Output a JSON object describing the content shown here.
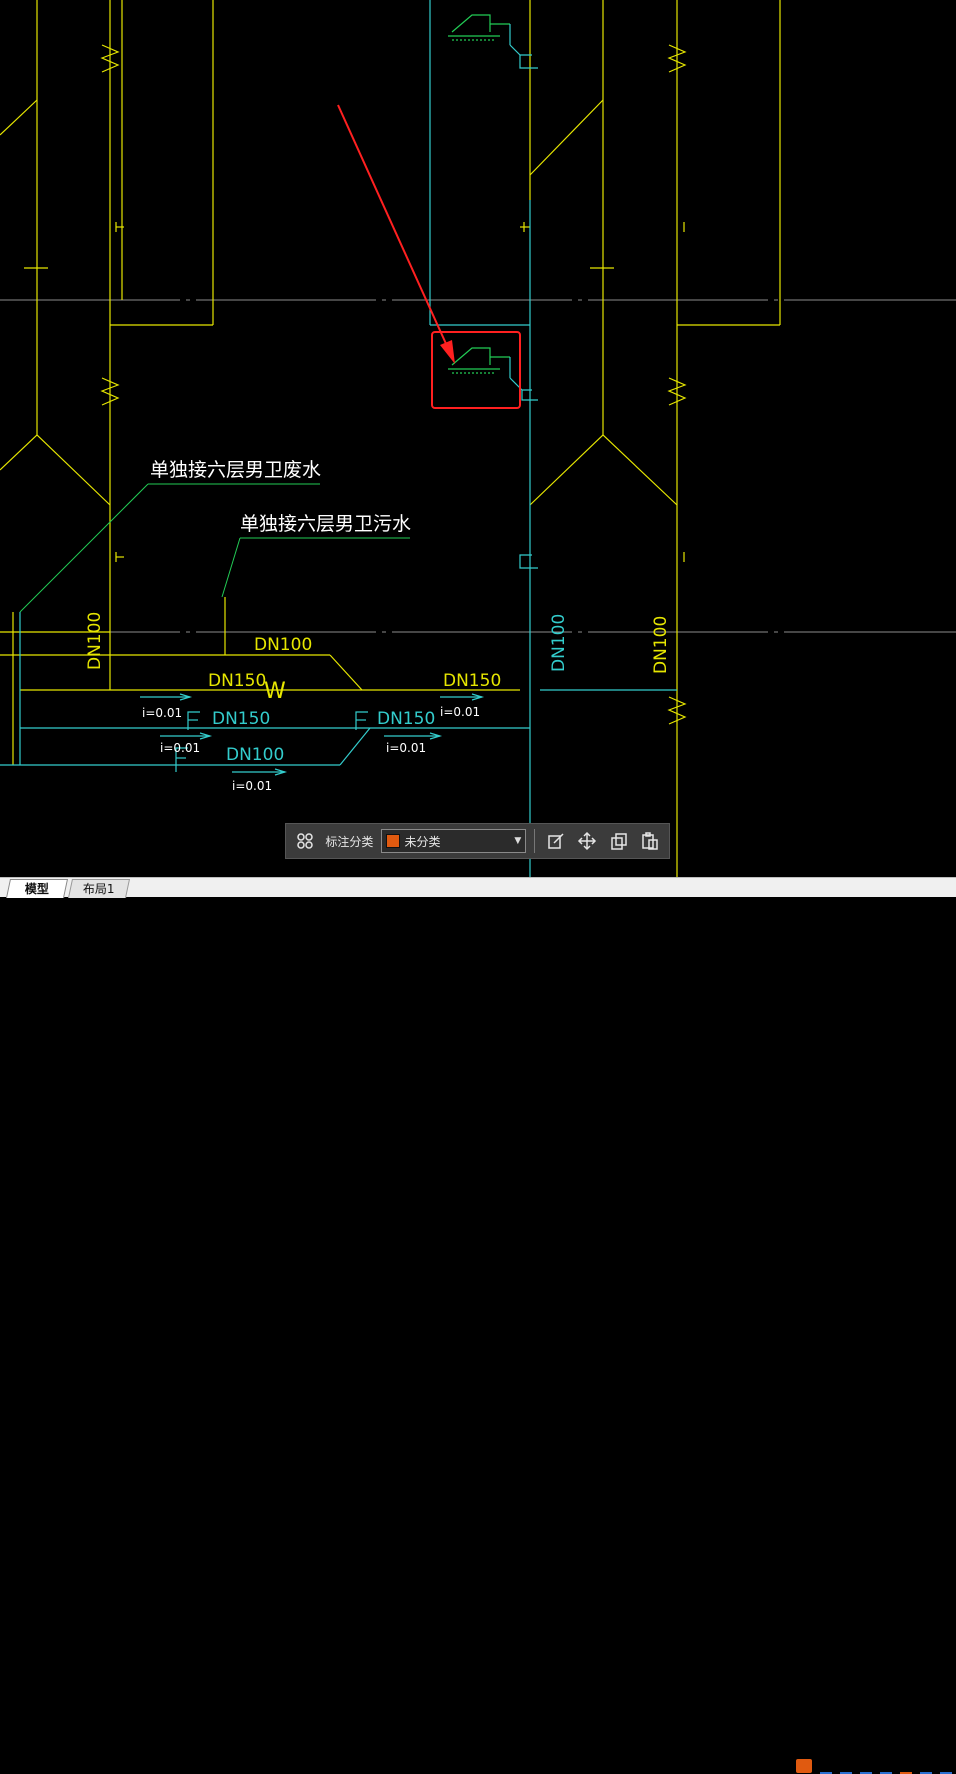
{
  "annotations": {
    "label_waste": "单独接六层男卫废水",
    "label_sewage": "单独接六层男卫污水"
  },
  "pipes": {
    "dn100_left_vertical": "DN100",
    "dn100_top": "DN100",
    "dn150_left": "DN150",
    "dn150_right": "DN150",
    "dn150_mid1": "DN150",
    "dn150_mid2": "DN150",
    "dn100_bottom": "DN100",
    "dn100_center_vertical": "DN100",
    "dn100_right_vertical": "DN100",
    "slope_1": "i=0.01",
    "slope_2": "i=0.01",
    "slope_3": "i=0.01",
    "slope_4": "i=0.01",
    "slope_5": "i=0.01",
    "marker_w": "W",
    "marker_f": "F"
  },
  "toolbar": {
    "category_label": "标注分类",
    "category_value": "未分类",
    "category_color": "#e05a10"
  },
  "tabs": {
    "model": "模型",
    "layout1": "布局1"
  },
  "colors": {
    "background": "#000000",
    "yellow": "#e6e600",
    "cyan": "#33cccc",
    "green": "#22cc55",
    "red": "#ff2020",
    "white": "#ffffff",
    "gray": "#8c8c8c"
  },
  "icons": [
    "view-grid-icon",
    "edit-icon",
    "move-icon",
    "copy-icon",
    "paste-icon"
  ]
}
